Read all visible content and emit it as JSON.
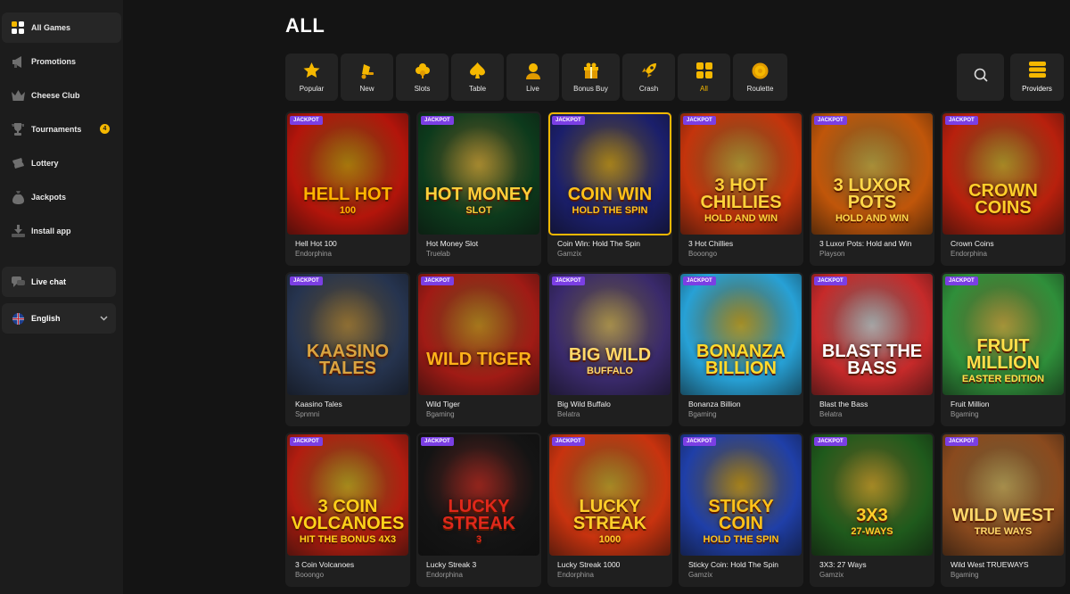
{
  "sidebar": {
    "items": [
      {
        "label": "All Games",
        "icon": "grid-icon",
        "active": true
      },
      {
        "label": "Promotions",
        "icon": "megaphone-icon"
      },
      {
        "label": "Cheese Club",
        "icon": "crown-icon"
      },
      {
        "label": "Tournaments",
        "icon": "trophy-icon",
        "badge": "4"
      },
      {
        "label": "Lottery",
        "icon": "ticket-icon"
      },
      {
        "label": "Jackpots",
        "icon": "money-bag-icon"
      },
      {
        "label": "Install app",
        "icon": "download-icon"
      }
    ],
    "live_chat": "Live chat",
    "language": "English"
  },
  "page": {
    "title": "ALL"
  },
  "categories": [
    {
      "label": "Popular",
      "icon": "star-icon"
    },
    {
      "label": "New",
      "icon": "bell-icon"
    },
    {
      "label": "Slots",
      "icon": "clover-icon"
    },
    {
      "label": "Table",
      "icon": "spade-icon"
    },
    {
      "label": "Live",
      "icon": "dealer-icon"
    },
    {
      "label": "Bonus Buy",
      "icon": "gift-icon"
    },
    {
      "label": "Crash",
      "icon": "rocket-icon"
    },
    {
      "label": "All",
      "icon": "grid-icon",
      "active": true
    },
    {
      "label": "Roulette",
      "icon": "roulette-icon"
    }
  ],
  "providers_label": "Providers",
  "jackpot_label": "JACKPOT",
  "games": [
    {
      "name": "Hell Hot 100",
      "provider": "Endorphina",
      "logo1": "HELL HOT",
      "logo2": "100",
      "bg": "#b3150b",
      "accent": "#ffb300"
    },
    {
      "name": "Hot Money Slot",
      "provider": "Truelab",
      "logo1": "HOT MONEY",
      "logo2": "SLOT",
      "bg": "#0d3a1c",
      "accent": "#ffcf3a"
    },
    {
      "name": "Coin Win: Hold The Spin",
      "provider": "Gamzix",
      "logo1": "COIN WIN",
      "logo2": "HOLD THE SPIN",
      "bg": "#1b1f6b",
      "accent": "#ffc21a"
    },
    {
      "name": "3 Hot Chillies",
      "provider": "Booongo",
      "logo1": "3 HOT CHILLIES",
      "logo2": "HOLD AND WIN",
      "bg": "#c4340c",
      "accent": "#ffd23a"
    },
    {
      "name": "3 Luxor Pots: Hold and Win",
      "provider": "Playson",
      "logo1": "3 LUXOR POTS",
      "logo2": "HOLD AND WIN",
      "bg": "#c0560a",
      "accent": "#ffd84a"
    },
    {
      "name": "Crown Coins",
      "provider": "Endorphina",
      "logo1": "CROWN COINS",
      "logo2": "",
      "bg": "#b8200d",
      "accent": "#ffcf2a"
    },
    {
      "name": "Kaasino Tales",
      "provider": "Spnmni",
      "logo1": "KAASINO TALES",
      "logo2": "",
      "bg": "#26344f",
      "accent": "#d9a441"
    },
    {
      "name": "Wild Tiger",
      "provider": "Bgaming",
      "logo1": "WILD TIGER",
      "logo2": "",
      "bg": "#a01b15",
      "accent": "#ffb21a"
    },
    {
      "name": "Big Wild Buffalo",
      "provider": "Belatra",
      "logo1": "BIG WILD",
      "logo2": "BUFFALO",
      "bg": "#3a2a6b",
      "accent": "#ffd86a"
    },
    {
      "name": "Bonanza Billion",
      "provider": "Bgaming",
      "logo1": "BONANZA BILLION",
      "logo2": "",
      "bg": "#27a1d6",
      "accent": "#ffdb2e"
    },
    {
      "name": "Blast the Bass",
      "provider": "Belatra",
      "logo1": "BLAST THE BASS",
      "logo2": "",
      "bg": "#c62a2a",
      "accent": "#ffffff"
    },
    {
      "name": "Fruit Million",
      "provider": "Bgaming",
      "logo1": "FRUIT MILLION",
      "logo2": "EASTER EDITION",
      "bg": "#2f8f3a",
      "accent": "#ffe04a"
    },
    {
      "name": "3 Coin Volcanoes",
      "provider": "Booongo",
      "logo1": "3 COIN VOLCANOES",
      "logo2": "HIT THE BONUS 4x3",
      "bg": "#b21d10",
      "accent": "#ffd21a"
    },
    {
      "name": "Lucky Streak 3",
      "provider": "Endorphina",
      "logo1": "LUCKY STREAK",
      "logo2": "3",
      "bg": "#141414",
      "accent": "#e0281b"
    },
    {
      "name": "Lucky Streak 1000",
      "provider": "Endorphina",
      "logo1": "LUCKY STREAK",
      "logo2": "1000",
      "bg": "#c8330f",
      "accent": "#ffcf2a"
    },
    {
      "name": "Sticky Coin: Hold The Spin",
      "provider": "Gamzix",
      "logo1": "STICKY COIN",
      "logo2": "HOLD THE SPIN",
      "bg": "#1f3fa8",
      "accent": "#ffc21a"
    },
    {
      "name": "3X3: 27 Ways",
      "provider": "Gamzix",
      "logo1": "3X3",
      "logo2": "27-WAYS",
      "bg": "#1f5a1c",
      "accent": "#ffcf2a"
    },
    {
      "name": "Wild West TRUEWAYS",
      "provider": "Bgaming",
      "logo1": "WILD WEST",
      "logo2": "TRUE WAYS",
      "bg": "#8a4a1e",
      "accent": "#ffd86a"
    }
  ],
  "highlighted_game_index": 2
}
